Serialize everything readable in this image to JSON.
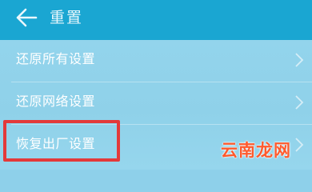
{
  "header": {
    "title": "重置"
  },
  "menu": {
    "items": [
      {
        "label": "还原所有设置"
      },
      {
        "label": "还原网络设置"
      },
      {
        "label": "恢复出厂设置"
      }
    ]
  },
  "watermark": "云南龙网",
  "colors": {
    "header_bg": "#1aa6d2",
    "list_bg": "#8ed0ea",
    "highlight": "#e33a3a",
    "watermark": "#ff5a2d"
  },
  "icons": [
    "back-arrow-icon",
    "chevron-right-icon"
  ]
}
